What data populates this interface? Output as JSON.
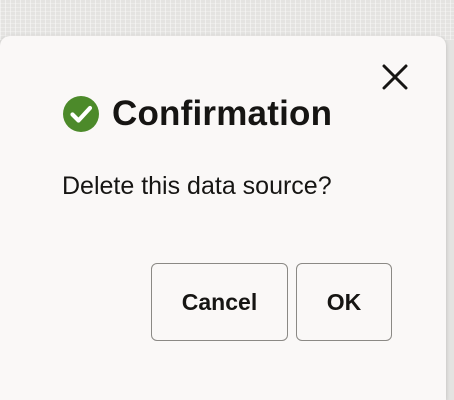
{
  "dialog": {
    "title": "Confirmation",
    "message": "Delete this data source?",
    "title_icon": "check-circle-icon",
    "close_icon": "close-icon",
    "success_color": "#4c8a2a"
  },
  "buttons": {
    "cancel_label": "Cancel",
    "ok_label": "OK"
  }
}
